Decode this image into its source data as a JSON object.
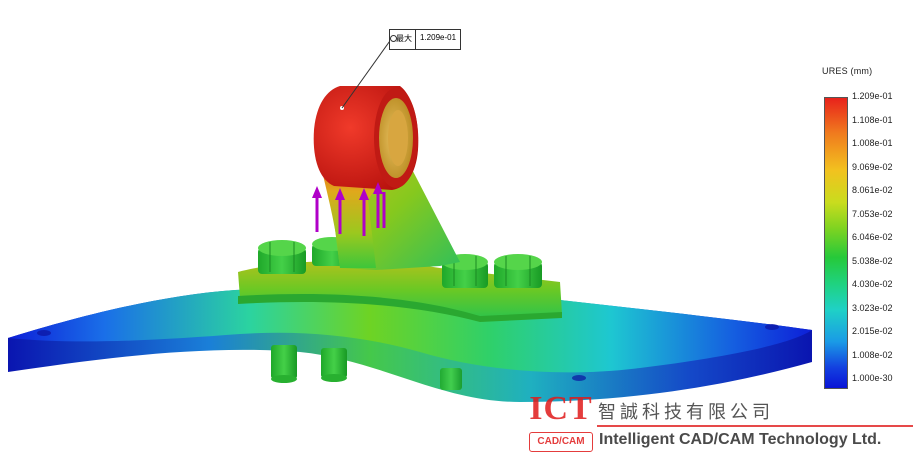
{
  "probe": {
    "label": "最大",
    "value": "1.209e-01"
  },
  "legend": {
    "title": "URES (mm)",
    "labels": [
      "1.209e-01",
      "1.108e-01",
      "1.008e-01",
      "9.069e-02",
      "8.061e-02",
      "7.053e-02",
      "6.046e-02",
      "5.038e-02",
      "4.030e-02",
      "3.023e-02",
      "2.015e-02",
      "1.008e-02",
      "1.000e-30"
    ]
  },
  "logo": {
    "ict": "ICT",
    "cadcam": "CAD/CAM",
    "chinese_name": "智誠科技有限公司",
    "english_name": "Intelligent CAD/CAM Technology Ltd."
  },
  "colors": {
    "max": "#e8221b",
    "min": "#0a14d6",
    "arrows": "#b000c8",
    "logo": "#e01b1b"
  }
}
